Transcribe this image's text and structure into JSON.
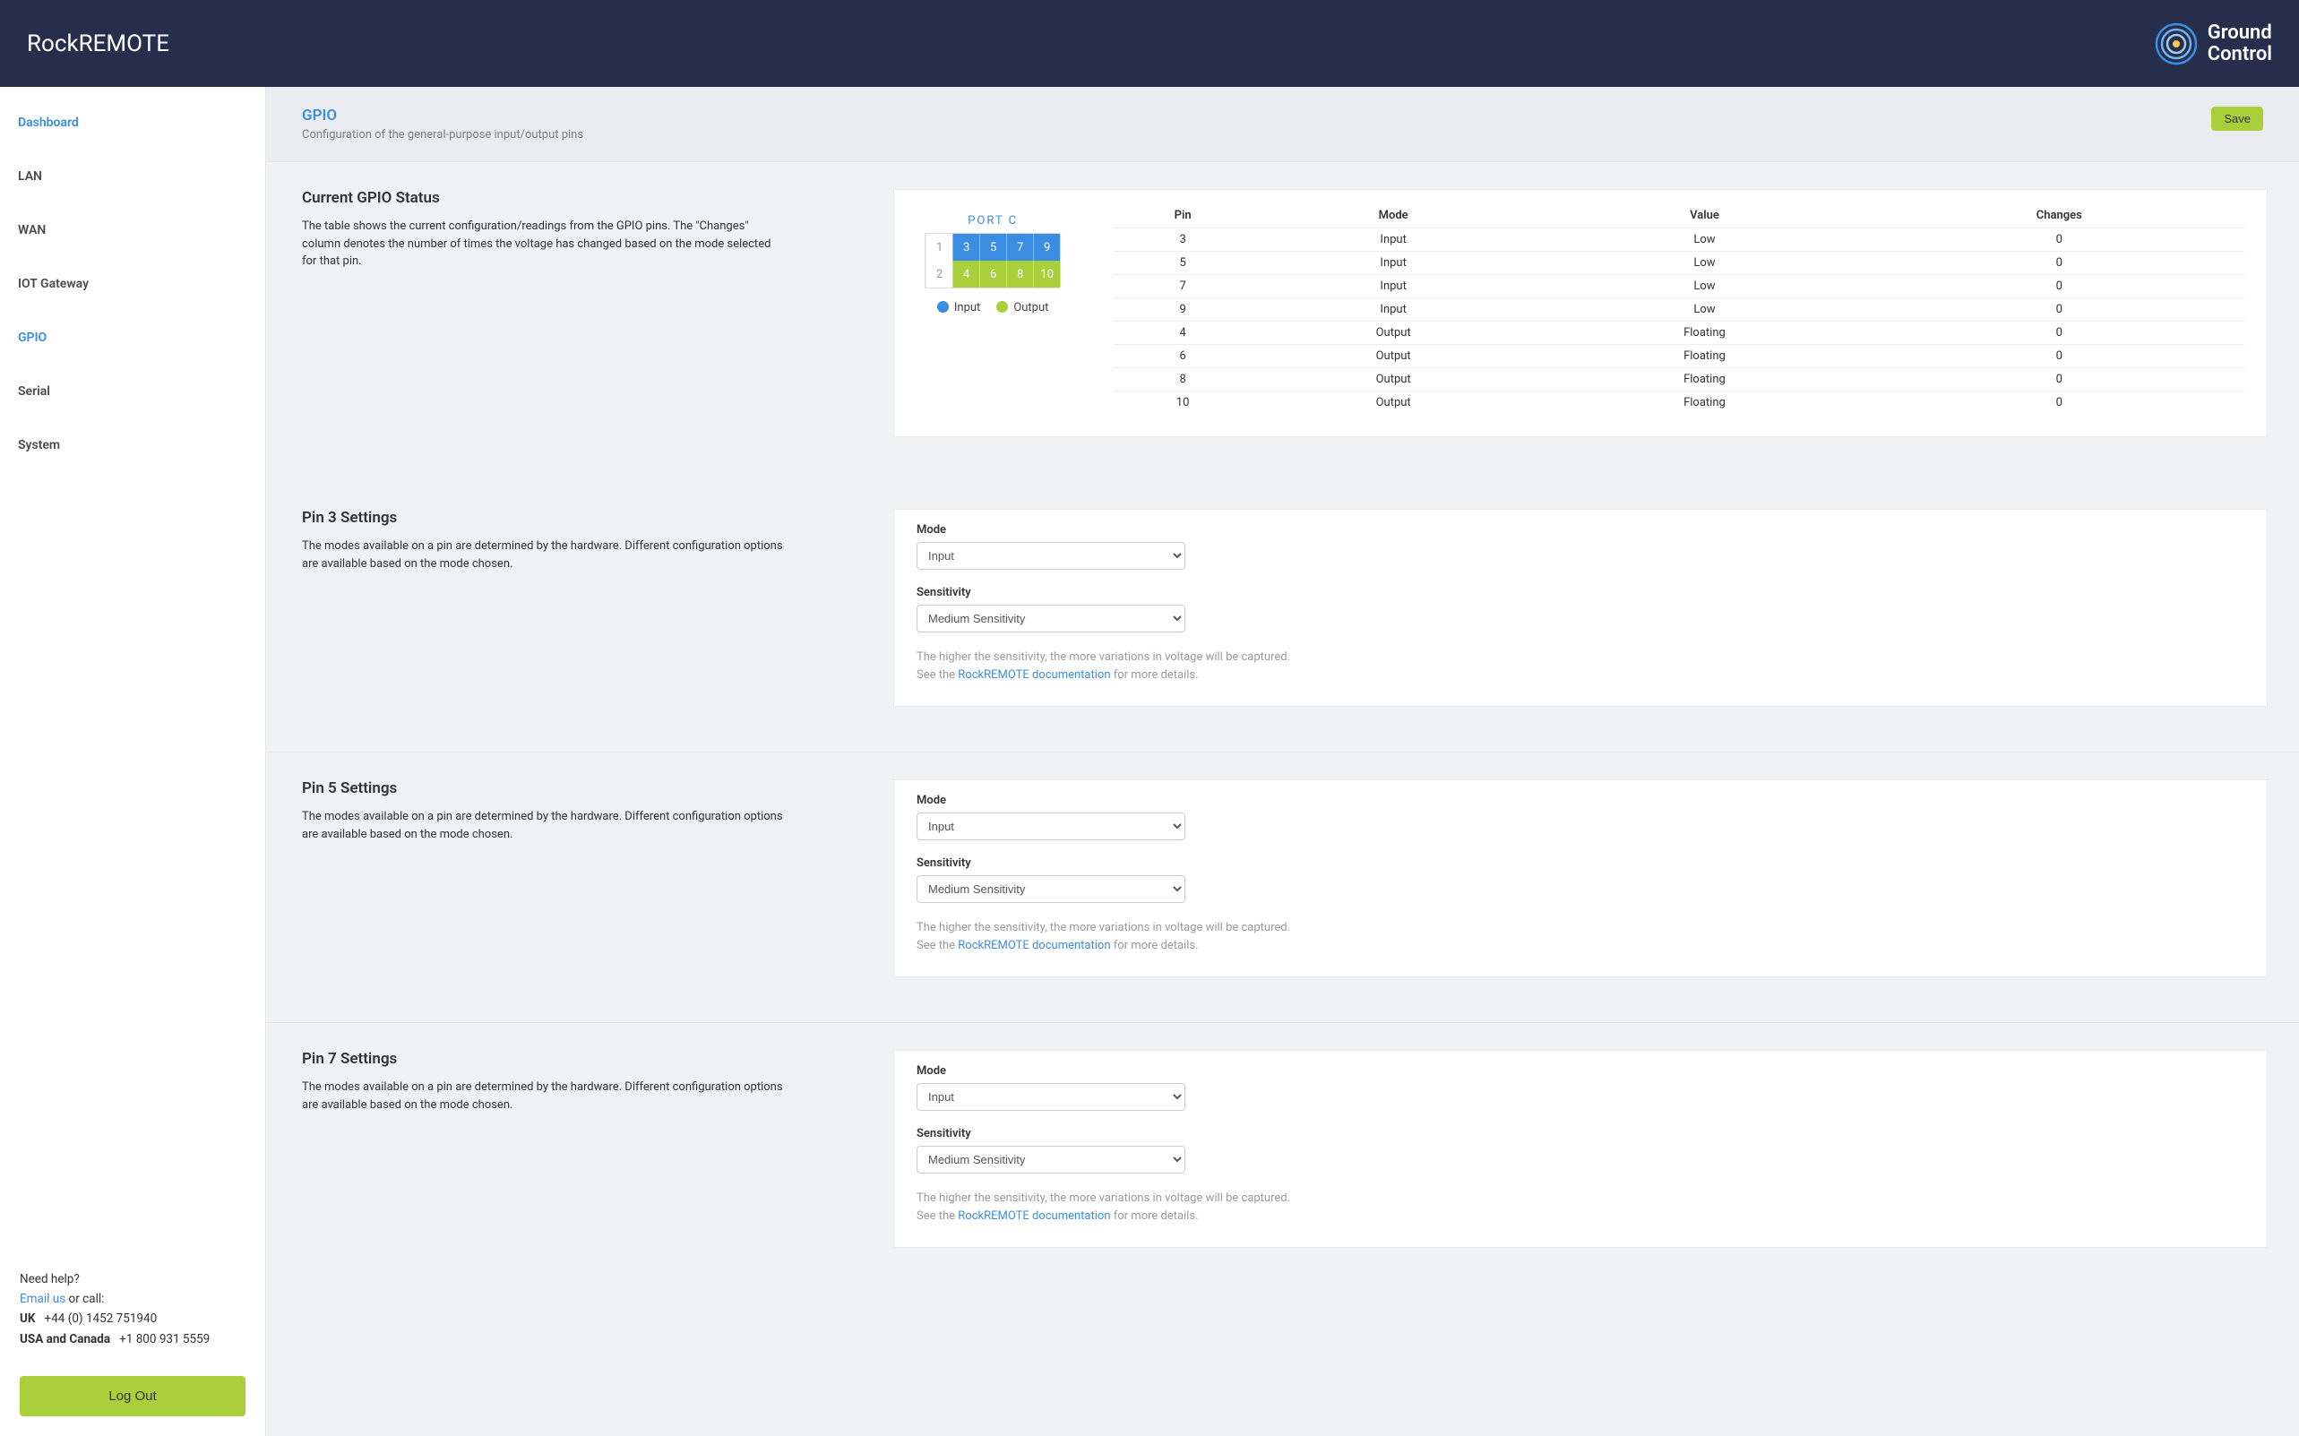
{
  "topbar": {
    "product": "RockREMOTE",
    "brand_line1": "Ground",
    "brand_line2": "Control"
  },
  "sidebar": {
    "items": [
      {
        "label": "Dashboard",
        "active": true
      },
      {
        "label": "LAN",
        "active": false
      },
      {
        "label": "WAN",
        "active": false
      },
      {
        "label": "IOT Gateway",
        "active": false
      },
      {
        "label": "GPIO",
        "active": true
      },
      {
        "label": "Serial",
        "active": false
      },
      {
        "label": "System",
        "active": false
      }
    ],
    "help": {
      "need_help": "Need help?",
      "email_us": "Email us",
      "or_call": " or call:",
      "uk_label": "UK",
      "uk_phone": "+44 (0) 1452 751940",
      "usa_label": "USA and Canada",
      "usa_phone": "+1 800 931 5559"
    },
    "logout": "Log Out"
  },
  "page": {
    "title": "GPIO",
    "subtitle": "Configuration of the general-purpose input/output pins",
    "save": "Save"
  },
  "status": {
    "title": "Current GPIO Status",
    "desc": "The table shows the current configuration/readings from the GPIO pins. The \"Changes\" column denotes the number of times the voltage has changed based on the mode selected for that pin.",
    "port_name": "PORT C",
    "legend_input": "Input",
    "legend_output": "Output",
    "pin_layout": {
      "row1": [
        "1",
        "3",
        "5",
        "7",
        "9"
      ],
      "row2": [
        "2",
        "4",
        "6",
        "8",
        "10"
      ]
    },
    "columns": [
      "Pin",
      "Mode",
      "Value",
      "Changes"
    ],
    "rows": [
      {
        "pin": "3",
        "mode": "Input",
        "value": "Low",
        "changes": "0"
      },
      {
        "pin": "5",
        "mode": "Input",
        "value": "Low",
        "changes": "0"
      },
      {
        "pin": "7",
        "mode": "Input",
        "value": "Low",
        "changes": "0"
      },
      {
        "pin": "9",
        "mode": "Input",
        "value": "Low",
        "changes": "0"
      },
      {
        "pin": "4",
        "mode": "Output",
        "value": "Floating",
        "changes": "0"
      },
      {
        "pin": "6",
        "mode": "Output",
        "value": "Floating",
        "changes": "0"
      },
      {
        "pin": "8",
        "mode": "Output",
        "value": "Floating",
        "changes": "0"
      },
      {
        "pin": "10",
        "mode": "Output",
        "value": "Floating",
        "changes": "0"
      }
    ]
  },
  "pin_settings_desc": "The modes available on a pin are determined by the hardware. Different configuration options are available based on the mode chosen.",
  "form": {
    "mode_label": "Mode",
    "mode_value": "Input",
    "sensitivity_label": "Sensitivity",
    "sensitivity_value": "Medium Sensitivity",
    "hint1": "The higher the sensitivity, the more variations in voltage will be captured.",
    "hint2a": "See the ",
    "hint_link": "RockREMOTE documentation",
    "hint2b": " for more details."
  },
  "pin_sections": [
    {
      "title": "Pin 3 Settings"
    },
    {
      "title": "Pin 5 Settings"
    },
    {
      "title": "Pin 7 Settings"
    }
  ]
}
